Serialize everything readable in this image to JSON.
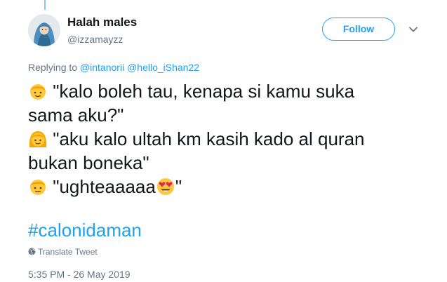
{
  "author": {
    "display_name": "Halah males",
    "handle": "@izzamayzz",
    "avatar_icon": "hijab-woman-avatar"
  },
  "header": {
    "follow_label": "Follow",
    "menu_icon": "chevron-down-icon"
  },
  "reply": {
    "prefix": "Replying to",
    "mentions": [
      "@intanorii",
      "@hello_iShan22"
    ]
  },
  "tweet": {
    "lines": [
      "\"kalo boleh tau, kenapa si kamu suka",
      "sama aku?\"",
      "\"aku kalo ultah km kasih kado al quran",
      "bukan boneka\"",
      "\"ughteaaaaa",
      "\""
    ],
    "emojis": [
      "boy-emoji",
      "girl-emoji",
      "boy-emoji",
      "heart-eyes-emoji"
    ],
    "hashtag": "#calonidaman"
  },
  "footer": {
    "translate_label": "Translate Tweet",
    "timestamp": "5:35 PM - 26 May 2019"
  },
  "colors": {
    "accent": "#1da1f2",
    "text": "#14171a",
    "secondary": "#657786",
    "emoji_yellow": "#ffc83d",
    "emoji_hair": "#f7a600",
    "heart": "#e0245e"
  }
}
